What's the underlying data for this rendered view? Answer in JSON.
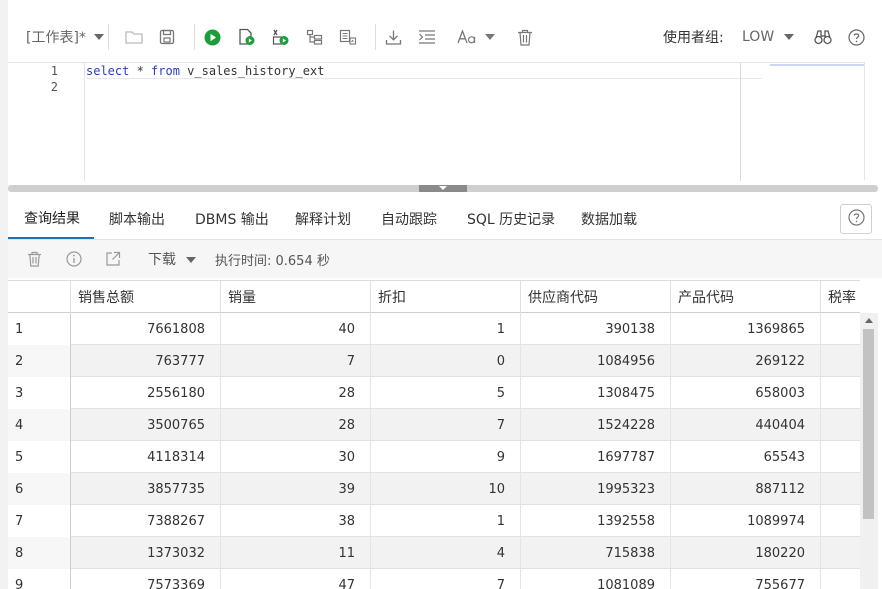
{
  "toolbar": {
    "worksheet_label": "[工作表]*",
    "usergroup_label": "使用者组:",
    "usergroup_value": "LOW"
  },
  "editor": {
    "line_numbers": [
      "1",
      "2"
    ],
    "sql": {
      "kw_select": "select",
      "star": " * ",
      "kw_from": "from",
      "table": " v_sales_history_ext"
    }
  },
  "tabs": [
    "查询结果",
    "脚本输出",
    "DBMS 输出",
    "解释计划",
    "自动跟踪",
    "SQL 历史记录",
    "数据加载"
  ],
  "results": {
    "download_label": "下载",
    "exec_time": "执行时间: 0.654 秒"
  },
  "grid": {
    "columns": [
      "销售总额",
      "销量",
      "折扣",
      "供应商代码",
      "产品代码",
      "税率"
    ],
    "rows": [
      [
        "1",
        "7661808",
        "40",
        "1",
        "390138",
        "1369865"
      ],
      [
        "2",
        "763777",
        "7",
        "0",
        "1084956",
        "269122"
      ],
      [
        "3",
        "2556180",
        "28",
        "5",
        "1308475",
        "658003"
      ],
      [
        "4",
        "3500765",
        "28",
        "7",
        "1524228",
        "440404"
      ],
      [
        "5",
        "4118314",
        "30",
        "9",
        "1697787",
        "65543"
      ],
      [
        "6",
        "3857735",
        "39",
        "10",
        "1995323",
        "887112"
      ],
      [
        "7",
        "7388267",
        "38",
        "1",
        "1392558",
        "1089974"
      ],
      [
        "8",
        "1373032",
        "11",
        "4",
        "715838",
        "180220"
      ],
      [
        "9",
        "7573369",
        "47",
        "7",
        "1081089",
        "755677"
      ]
    ]
  },
  "icons": {
    "run_color": "#1a9e3a",
    "accent": "#1f6fb2"
  }
}
